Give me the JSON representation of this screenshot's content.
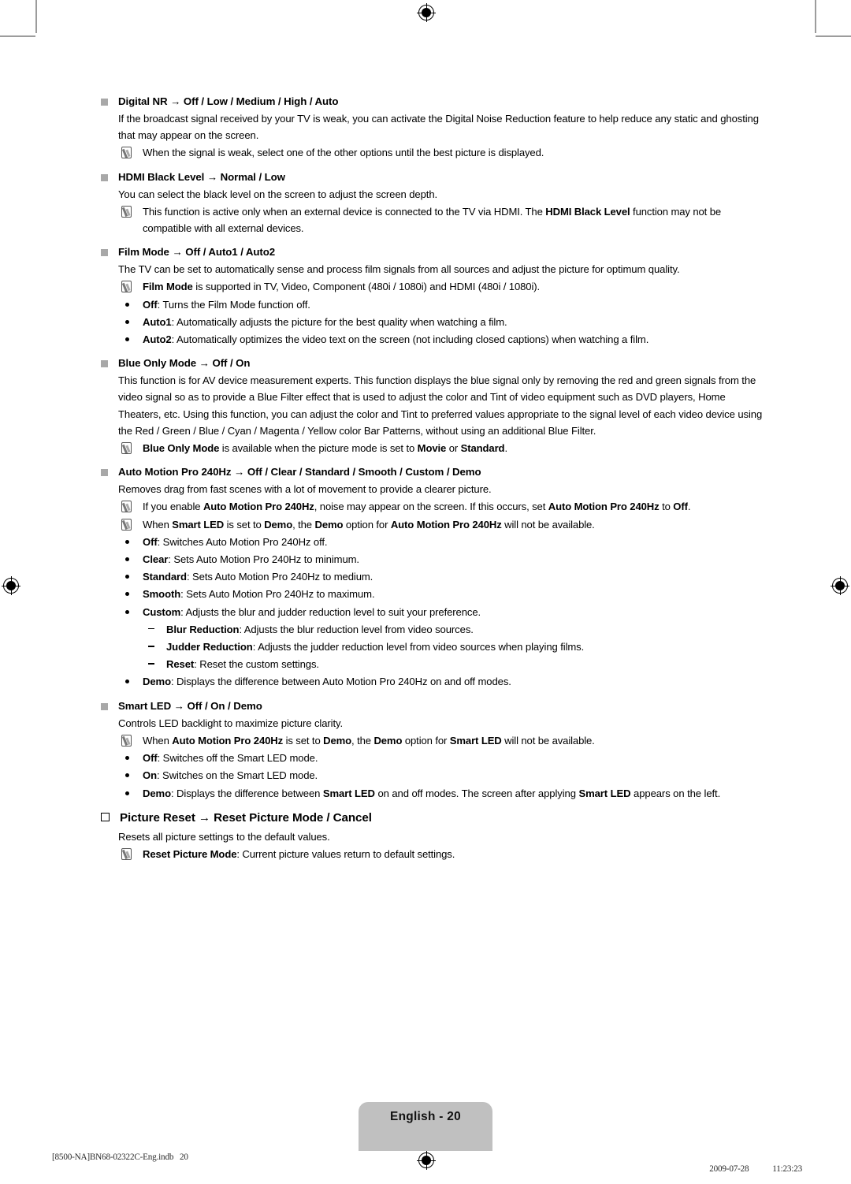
{
  "document": {
    "page_label": "English - 20",
    "footer_left": "[8500-NA]BN68-02322C-Eng.indb   20",
    "footer_date": "2009-07-28",
    "footer_tofu": "　　",
    "footer_time": "11:23:23"
  },
  "sections": [
    {
      "id": "digital-nr",
      "marker": "square",
      "heading_bold": "Digital NR",
      "heading_rest": " → Off / Low / Medium / High / Auto",
      "body": [
        {
          "type": "para",
          "text": "If the broadcast signal received by your TV is weak, you can activate the Digital Noise Reduction feature to help reduce any static and ghosting that may appear on the screen."
        },
        {
          "type": "note",
          "text": "When the signal is weak, select one of the other options until the best picture is displayed."
        }
      ]
    },
    {
      "id": "hdmi-black-level",
      "marker": "square",
      "heading_bold": "HDMI Black Level",
      "heading_rest": " → Normal / Low",
      "body": [
        {
          "type": "para",
          "text": "You can select the black level on the screen to adjust the screen depth."
        },
        {
          "type": "note",
          "parts": [
            {
              "t": "This function is active only when an external device is connected to the TV via HDMI. The ",
              "b": false
            },
            {
              "t": "HDMI Black Level",
              "b": true
            },
            {
              "t": " function may not be compatible with all external devices.",
              "b": false
            }
          ]
        }
      ]
    },
    {
      "id": "film-mode",
      "marker": "square",
      "heading_bold": "Film Mode",
      "heading_rest": " → Off / Auto1 / Auto2",
      "body": [
        {
          "type": "para",
          "text": "The TV can be set to automatically sense and process film signals from all sources and adjust the picture for optimum quality."
        },
        {
          "type": "note",
          "parts": [
            {
              "t": "Film Mode",
              "b": true
            },
            {
              "t": " is supported in TV, Video, Component (480i / 1080i) and HDMI (480i / 1080i).",
              "b": false
            }
          ]
        },
        {
          "type": "dot",
          "parts": [
            {
              "t": "Off",
              "b": true
            },
            {
              "t": ": Turns the Film Mode function off.",
              "b": false
            }
          ]
        },
        {
          "type": "dot",
          "parts": [
            {
              "t": "Auto1",
              "b": true
            },
            {
              "t": ": Automatically adjusts the picture for the best quality when watching a film.",
              "b": false
            }
          ]
        },
        {
          "type": "dot",
          "parts": [
            {
              "t": "Auto2",
              "b": true
            },
            {
              "t": ": Automatically optimizes the video text on the screen (not including closed captions) when watching a film.",
              "b": false
            }
          ]
        }
      ]
    },
    {
      "id": "blue-only-mode",
      "marker": "square",
      "heading_bold": "Blue Only Mode",
      "heading_rest": " → Off / On",
      "body": [
        {
          "type": "para",
          "text": "This function is for AV device measurement experts. This function displays the blue signal only by removing the red and green signals from the video signal so as to provide a Blue Filter effect that is used to adjust the color and Tint of video equipment such as DVD players, Home Theaters, etc. Using this function, you can adjust the color and Tint to preferred values appropriate to the signal level of each video device using the Red / Green / Blue / Cyan / Magenta / Yellow color Bar Patterns, without using an additional Blue Filter."
        },
        {
          "type": "note",
          "parts": [
            {
              "t": "Blue Only Mode",
              "b": true
            },
            {
              "t": " is available when the picture mode is set to ",
              "b": false
            },
            {
              "t": "Movie",
              "b": true
            },
            {
              "t": " or ",
              "b": false
            },
            {
              "t": "Standard",
              "b": true
            },
            {
              "t": ".",
              "b": false
            }
          ]
        }
      ]
    },
    {
      "id": "auto-motion-pro-240hz",
      "marker": "square",
      "heading_bold": "Auto Motion Pro 240Hz",
      "heading_rest": " → Off / Clear / Standard / Smooth / Custom / Demo",
      "body": [
        {
          "type": "para",
          "text": "Removes drag from fast scenes with a lot of movement to provide a clearer picture."
        },
        {
          "type": "note",
          "parts": [
            {
              "t": "If you enable ",
              "b": false
            },
            {
              "t": "Auto Motion Pro 240Hz",
              "b": true
            },
            {
              "t": ", noise may appear on the screen. If this occurs, set ",
              "b": false
            },
            {
              "t": "Auto Motion Pro 240Hz",
              "b": true
            },
            {
              "t": " to ",
              "b": false
            },
            {
              "t": "Off",
              "b": true
            },
            {
              "t": ".",
              "b": false
            }
          ]
        },
        {
          "type": "note",
          "parts": [
            {
              "t": "When ",
              "b": false
            },
            {
              "t": "Smart LED",
              "b": true
            },
            {
              "t": " is set to ",
              "b": false
            },
            {
              "t": "Demo",
              "b": true
            },
            {
              "t": ", the ",
              "b": false
            },
            {
              "t": "Demo",
              "b": true
            },
            {
              "t": " option for ",
              "b": false
            },
            {
              "t": "Auto Motion Pro 240Hz",
              "b": true
            },
            {
              "t": " will not be available.",
              "b": false
            }
          ]
        },
        {
          "type": "dot",
          "parts": [
            {
              "t": "Off",
              "b": true
            },
            {
              "t": ": Switches Auto Motion Pro 240Hz off.",
              "b": false
            }
          ]
        },
        {
          "type": "dot",
          "parts": [
            {
              "t": "Clear",
              "b": true
            },
            {
              "t": ": Sets Auto Motion Pro 240Hz to minimum.",
              "b": false
            }
          ]
        },
        {
          "type": "dot",
          "parts": [
            {
              "t": "Standard",
              "b": true
            },
            {
              "t": ": Sets Auto Motion Pro 240Hz to medium.",
              "b": false
            }
          ]
        },
        {
          "type": "dot",
          "parts": [
            {
              "t": "Smooth",
              "b": true
            },
            {
              "t": ": Sets Auto Motion Pro 240Hz to maximum.",
              "b": false
            }
          ]
        },
        {
          "type": "dot",
          "parts": [
            {
              "t": "Custom",
              "b": true
            },
            {
              "t": ": Adjusts the blur and judder reduction level to suit your preference.",
              "b": false
            }
          ]
        },
        {
          "type": "dash",
          "parts": [
            {
              "t": "Blur Reduction",
              "b": true
            },
            {
              "t": ": Adjusts the blur reduction level from video sources.",
              "b": false
            }
          ]
        },
        {
          "type": "dash",
          "parts": [
            {
              "t": "Judder Reduction",
              "b": true
            },
            {
              "t": ": Adjusts the judder reduction level from video sources when playing films.",
              "b": false
            }
          ]
        },
        {
          "type": "dash",
          "parts": [
            {
              "t": "Reset",
              "b": true
            },
            {
              "t": ": Reset the custom settings.",
              "b": false
            }
          ]
        },
        {
          "type": "dot",
          "parts": [
            {
              "t": "Demo",
              "b": true
            },
            {
              "t": ": Displays the difference between Auto Motion Pro 240Hz on and off modes.",
              "b": false
            }
          ]
        }
      ]
    },
    {
      "id": "smart-led",
      "marker": "square",
      "heading_bold": "Smart LED",
      "heading_rest": " → Off / On / Demo",
      "body": [
        {
          "type": "para",
          "text": "Controls LED backlight to maximize picture clarity."
        },
        {
          "type": "note",
          "parts": [
            {
              "t": "When ",
              "b": false
            },
            {
              "t": "Auto Motion Pro 240Hz",
              "b": true
            },
            {
              "t": " is set to ",
              "b": false
            },
            {
              "t": "Demo",
              "b": true
            },
            {
              "t": ", the ",
              "b": false
            },
            {
              "t": "Demo",
              "b": true
            },
            {
              "t": " option for ",
              "b": false
            },
            {
              "t": "Smart LED",
              "b": true
            },
            {
              "t": " will not be available.",
              "b": false
            }
          ]
        },
        {
          "type": "dot",
          "parts": [
            {
              "t": "Off",
              "b": true
            },
            {
              "t": ": Switches off the Smart LED mode.",
              "b": false
            }
          ]
        },
        {
          "type": "dot",
          "parts": [
            {
              "t": "On",
              "b": true
            },
            {
              "t": ": Switches on the Smart LED mode.",
              "b": false
            }
          ]
        },
        {
          "type": "dot",
          "parts": [
            {
              "t": "Demo",
              "b": true
            },
            {
              "t": ": Displays the difference between ",
              "b": false
            },
            {
              "t": "Smart LED",
              "b": true
            },
            {
              "t": " on and off modes. The screen after applying ",
              "b": false
            },
            {
              "t": "Smart LED",
              "b": true
            },
            {
              "t": " appears on the left.",
              "b": false
            }
          ]
        }
      ]
    },
    {
      "id": "picture-reset",
      "marker": "box",
      "major": true,
      "heading_bold": "Picture Reset",
      "heading_rest": " → Reset Picture Mode / Cancel",
      "body": [
        {
          "type": "para",
          "text": "Resets all picture settings to the default values."
        },
        {
          "type": "note",
          "parts": [
            {
              "t": "Reset Picture Mode",
              "b": true
            },
            {
              "t": ": Current picture values return to default settings.",
              "b": false
            }
          ]
        }
      ]
    }
  ]
}
